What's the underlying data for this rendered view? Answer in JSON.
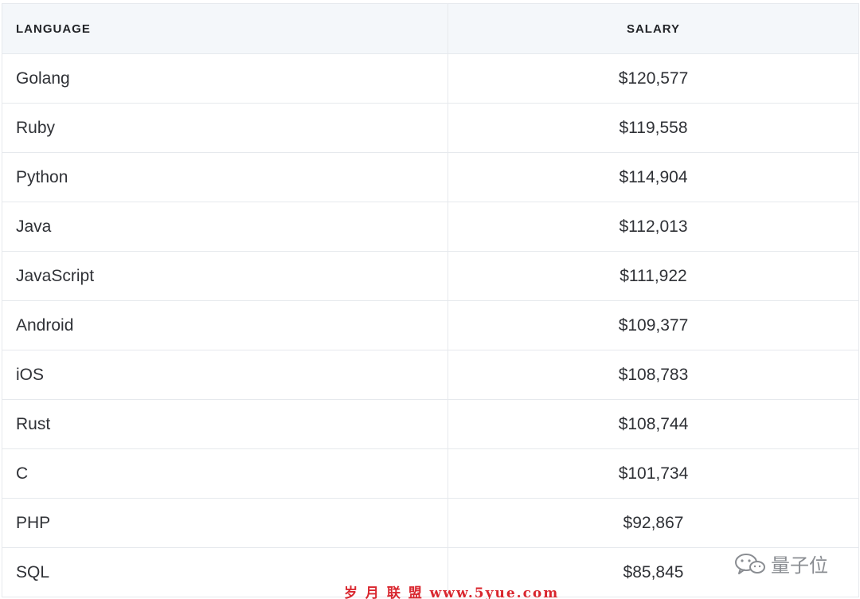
{
  "table": {
    "headers": {
      "language": "LANGUAGE",
      "salary": "SALARY"
    },
    "rows": [
      {
        "language": "Golang",
        "salary": "$120,577"
      },
      {
        "language": "Ruby",
        "salary": "$119,558"
      },
      {
        "language": "Python",
        "salary": "$114,904"
      },
      {
        "language": "Java",
        "salary": "$112,013"
      },
      {
        "language": "JavaScript",
        "salary": "$111,922"
      },
      {
        "language": "Android",
        "salary": "$109,377"
      },
      {
        "language": "iOS",
        "salary": "$108,783"
      },
      {
        "language": "Rust",
        "salary": "$108,744"
      },
      {
        "language": "C",
        "salary": "$101,734"
      },
      {
        "language": "PHP",
        "salary": "$92,867"
      },
      {
        "language": "SQL",
        "salary": "$85,845"
      }
    ]
  },
  "watermarks": {
    "wechat_account": "量子位",
    "wechat_icon": "wechat-icon",
    "site": "岁 月 联 盟  www.5yue.com"
  },
  "colors": {
    "header_background": "#f4f7fa",
    "border": "#e6e9ed",
    "site_watermark": "#d9262e"
  }
}
